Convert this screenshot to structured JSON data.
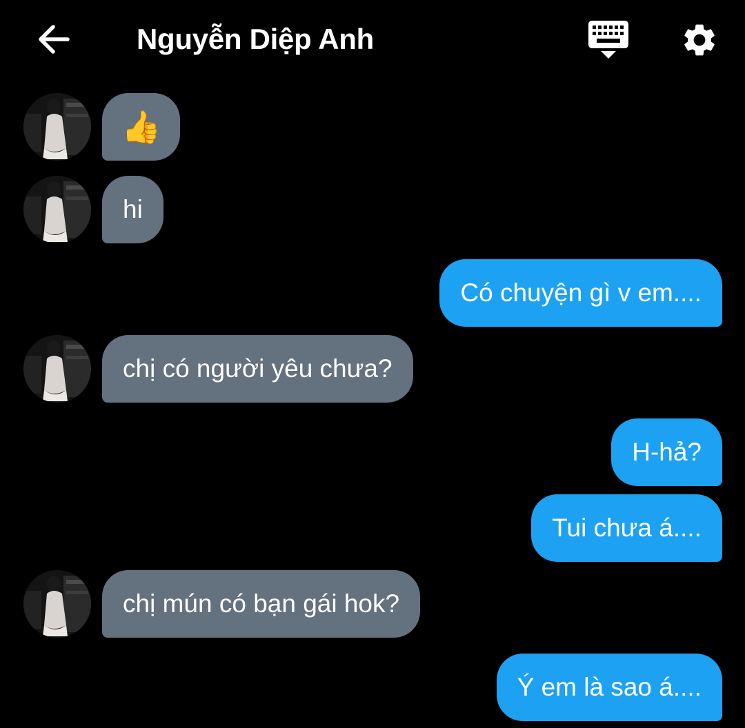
{
  "header": {
    "title": "Nguyễn Diệp Anh",
    "back_icon": "arrow-left-icon",
    "keyboard_icon": "keyboard-icon",
    "settings_icon": "gear-icon"
  },
  "colors": {
    "background": "#000000",
    "incoming_bubble": "#64717f",
    "outgoing_bubble": "#1da1f2",
    "text": "#ffffff"
  },
  "messages": [
    {
      "from": "them",
      "text": "👍"
    },
    {
      "from": "them",
      "text": "hi"
    },
    {
      "from": "me",
      "text": "Có chuyện gì v em...."
    },
    {
      "from": "them",
      "text": "chị có người yêu chưa?"
    },
    {
      "from": "me",
      "text": "H-hả?"
    },
    {
      "from": "me",
      "text": "Tui chưa á...."
    },
    {
      "from": "them",
      "text": "chị mún có bạn gái hok?"
    },
    {
      "from": "me",
      "text": "Ý em là sao á...."
    }
  ]
}
